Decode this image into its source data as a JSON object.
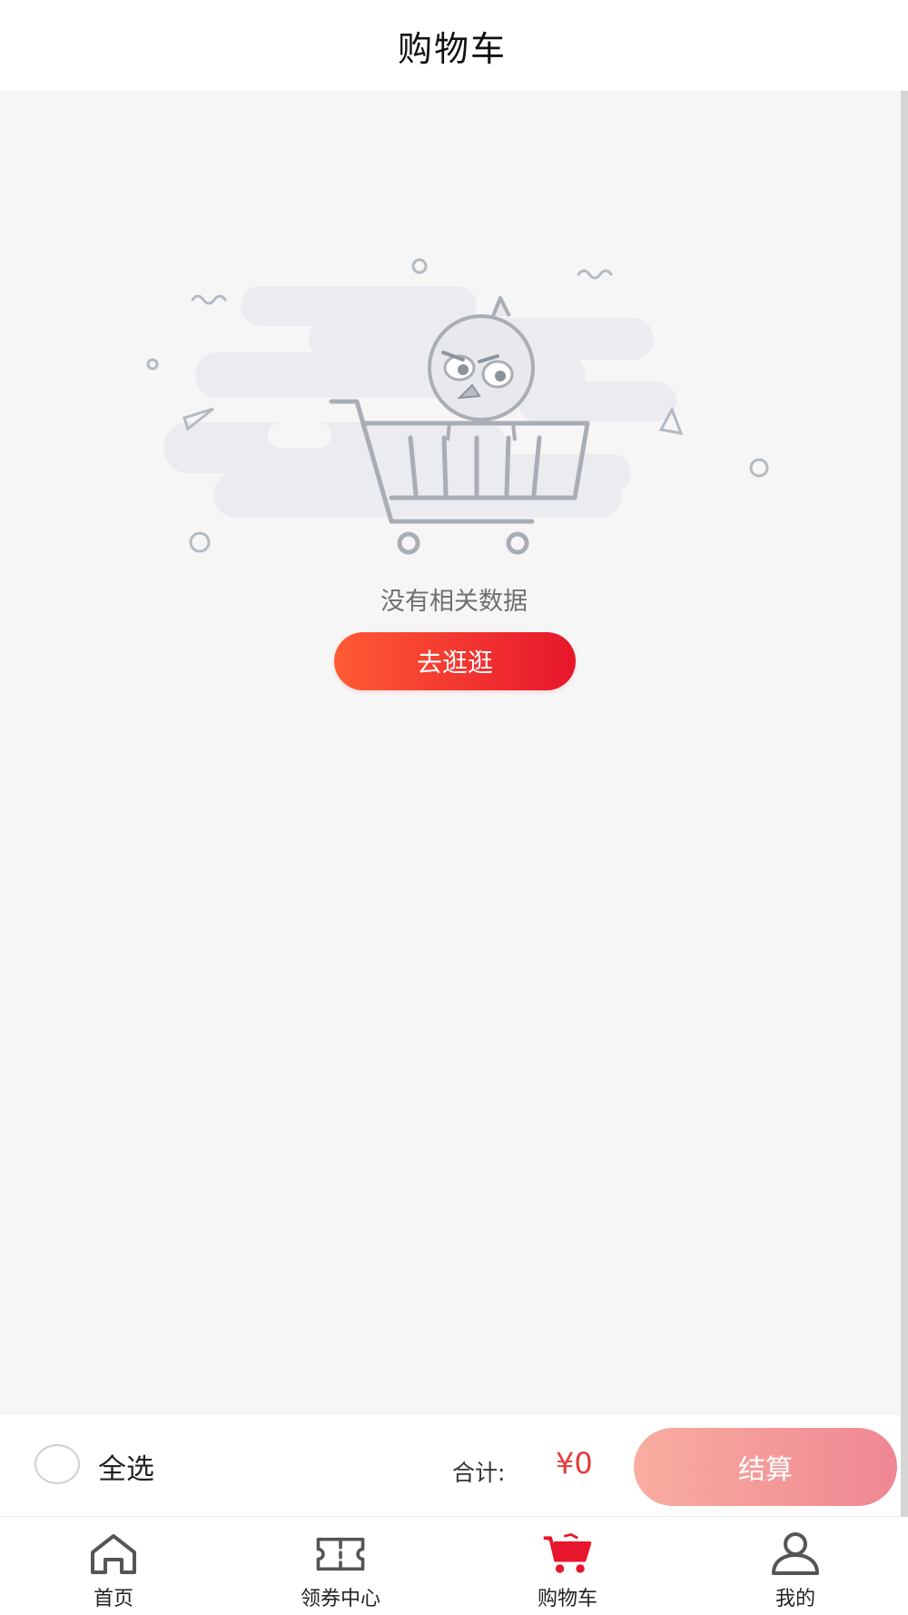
{
  "header": {
    "title": "购物车"
  },
  "empty_state": {
    "message": "没有相关数据",
    "button_label": "去逛逛"
  },
  "checkout": {
    "select_all_label": "全选",
    "total_label": "合计:",
    "total_value": "¥0",
    "button_label": "结算"
  },
  "tabbar": {
    "items": [
      {
        "label": "首页",
        "icon": "home-icon",
        "active": false
      },
      {
        "label": "领券中心",
        "icon": "ticket-icon",
        "active": false
      },
      {
        "label": "购物车",
        "icon": "cart-icon",
        "active": true
      },
      {
        "label": "我的",
        "icon": "person-icon",
        "active": false
      }
    ]
  },
  "colors": {
    "accent": "#e7162c",
    "price": "#e33a3a",
    "background": "#f6f6f7",
    "checkout_gradient_start": "#f9ad9f",
    "checkout_gradient_end": "#ef8794"
  }
}
